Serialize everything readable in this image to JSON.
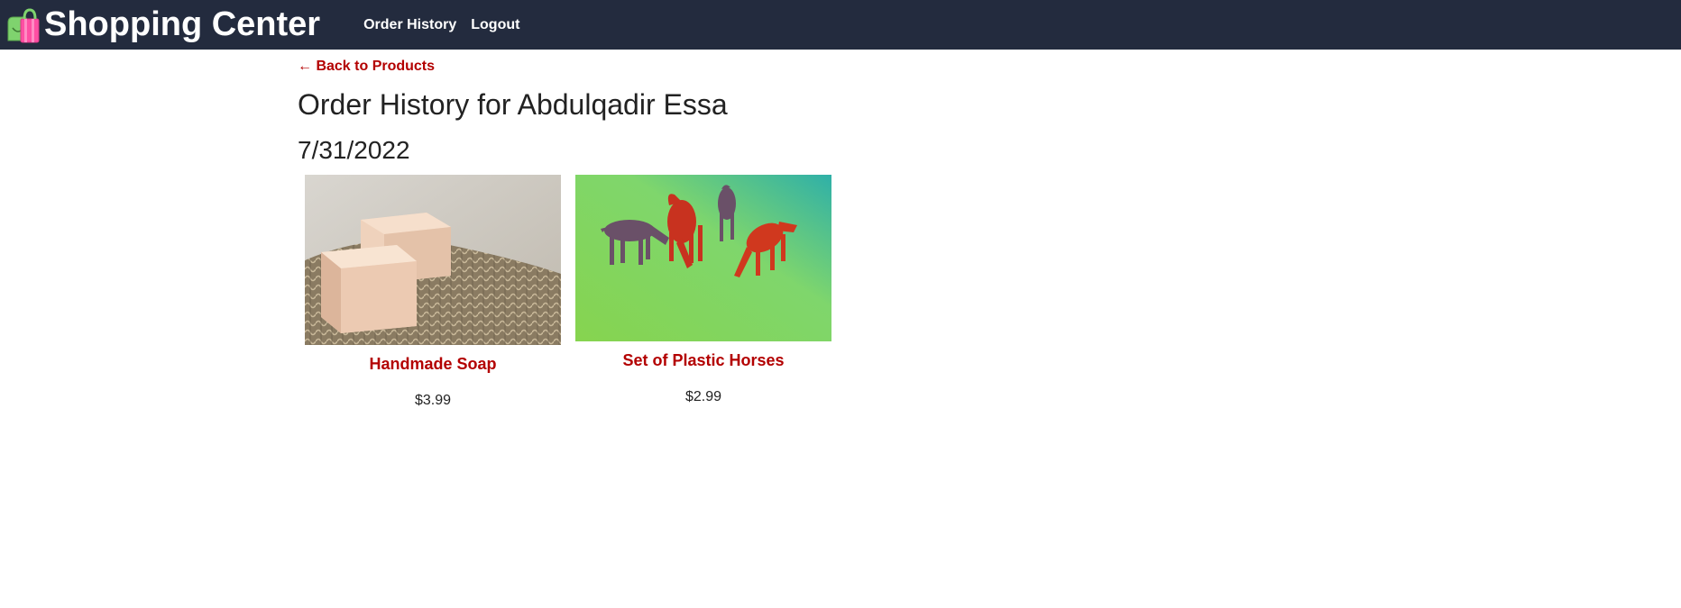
{
  "header": {
    "brand": "Shopping Center",
    "nav": {
      "order_history": "Order History",
      "logout": "Logout"
    }
  },
  "main": {
    "back_link": "← Back to Products",
    "title": "Order History for Abdulqadir Essa",
    "orders": [
      {
        "date": "7/31/2022",
        "items": [
          {
            "name": "Handmade Soap",
            "price": "$3.99"
          },
          {
            "name": "Set of Plastic Horses",
            "price": "$2.99"
          }
        ]
      }
    ]
  },
  "colors": {
    "navbar": "#232b3e",
    "link": "#b30000",
    "text": "#222222"
  }
}
